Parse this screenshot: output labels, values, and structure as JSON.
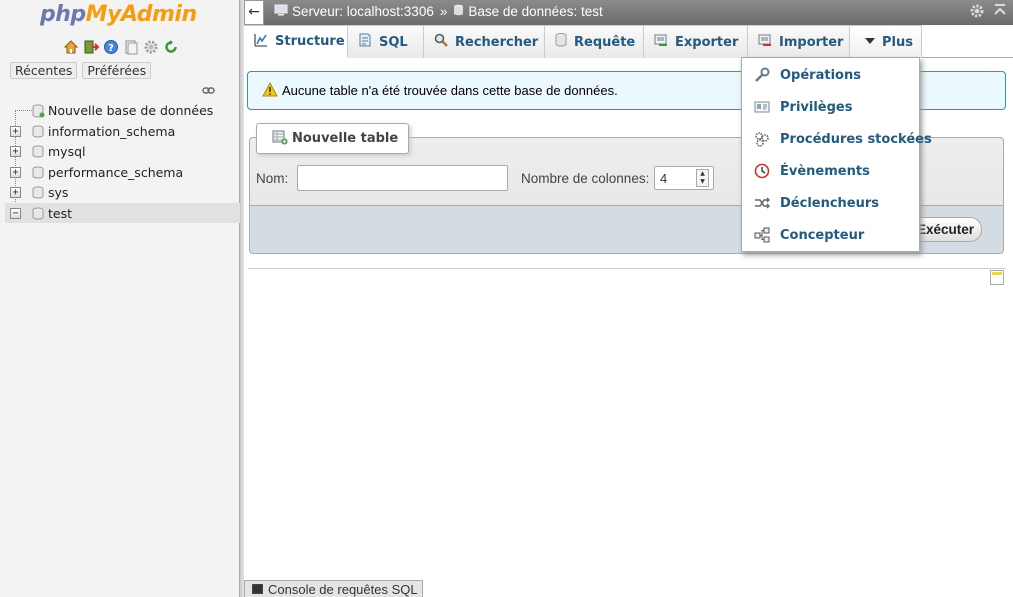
{
  "app": {
    "logo_php": "php",
    "logo_myadmin": "MyAdmin"
  },
  "nav": {
    "icons": [
      "home-icon",
      "exit-icon",
      "help-icon",
      "docs-icon",
      "settings-icon",
      "reload-icon"
    ],
    "tabs": [
      {
        "label": "Récentes"
      },
      {
        "label": "Préférées"
      }
    ],
    "tree": [
      {
        "label": "Nouvelle base de données",
        "expander": "",
        "selected": false
      },
      {
        "label": "information_schema",
        "expander": "+",
        "selected": false
      },
      {
        "label": "mysql",
        "expander": "+",
        "selected": false
      },
      {
        "label": "performance_schema",
        "expander": "+",
        "selected": false
      },
      {
        "label": "sys",
        "expander": "+",
        "selected": false
      },
      {
        "label": "test",
        "expander": "−",
        "selected": true
      }
    ]
  },
  "header": {
    "back": "←",
    "server": "Serveur: localhost:3306",
    "separator": "»",
    "database": "Base de données: test"
  },
  "menu": {
    "tabs": [
      {
        "label": "Structure",
        "icon": "structure-icon"
      },
      {
        "label": "SQL",
        "icon": "sql-icon"
      },
      {
        "label": "Rechercher",
        "icon": "search-icon"
      },
      {
        "label": "Requête",
        "icon": "query-icon"
      },
      {
        "label": "Exporter",
        "icon": "export-icon"
      },
      {
        "label": "Importer",
        "icon": "import-icon"
      },
      {
        "label": "Plus",
        "icon": "triangle-down-icon"
      }
    ],
    "more_items": [
      {
        "label": "Opérations",
        "icon": "wrench-icon"
      },
      {
        "label": "Privilèges",
        "icon": "privileges-icon"
      },
      {
        "label": "Procédures stockées",
        "icon": "routines-icon"
      },
      {
        "label": "Évènements",
        "icon": "clock-icon"
      },
      {
        "label": "Déclencheurs",
        "icon": "triggers-icon"
      },
      {
        "label": "Concepteur",
        "icon": "designer-icon"
      }
    ]
  },
  "main": {
    "notice": "Aucune table n'a été trouvée dans cette base de données.",
    "new_table": {
      "legend": "Nouvelle table",
      "name_label": "Nom:",
      "name_value": "",
      "columns_label": "Nombre de colonnes:",
      "columns_value": "4",
      "execute_label": "Exécuter"
    },
    "console_label": "Console de requêtes SQL"
  },
  "colors": {
    "link": "#235a81",
    "notice_border": "#2a97b4",
    "notice_bg": "#ebf8fd",
    "logo_php": "#6c78af",
    "logo_myadmin": "#f89c0e"
  }
}
